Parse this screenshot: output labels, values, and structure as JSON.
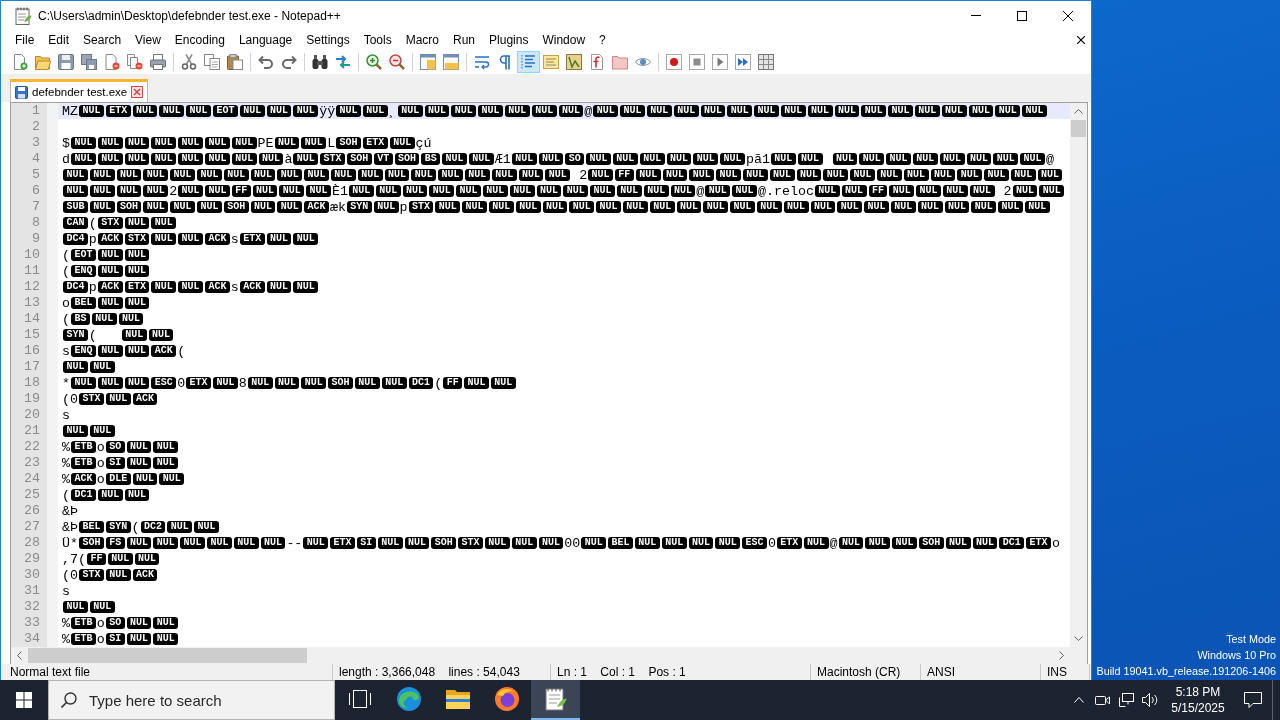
{
  "window": {
    "title": "C:\\Users\\admin\\Desktop\\defebnder test.exe - Notepad++"
  },
  "menu": [
    "File",
    "Edit",
    "Search",
    "View",
    "Encoding",
    "Language",
    "Settings",
    "Tools",
    "Macro",
    "Run",
    "Plugins",
    "Window",
    "?"
  ],
  "toolbar_groups": [
    {
      "buttons": [
        {
          "kind": "new",
          "pressed": false
        },
        {
          "kind": "open",
          "pressed": false
        },
        {
          "kind": "save",
          "pressed": false
        },
        {
          "kind": "save_all",
          "pressed": false
        },
        {
          "kind": "close",
          "pressed": false
        },
        {
          "kind": "close_all",
          "pressed": false
        },
        {
          "kind": "print",
          "pressed": false
        }
      ]
    },
    {
      "buttons": [
        {
          "kind": "cut",
          "pressed": false
        },
        {
          "kind": "copy",
          "pressed": false
        },
        {
          "kind": "paste",
          "pressed": false
        }
      ]
    },
    {
      "buttons": [
        {
          "kind": "undo",
          "pressed": false
        },
        {
          "kind": "redo",
          "pressed": false
        }
      ]
    },
    {
      "buttons": [
        {
          "kind": "find",
          "pressed": false
        },
        {
          "kind": "replace",
          "pressed": false
        }
      ]
    },
    {
      "buttons": [
        {
          "kind": "zoom_in",
          "pressed": false
        },
        {
          "kind": "zoom_out",
          "pressed": false
        }
      ]
    },
    {
      "buttons": [
        {
          "kind": "sync_vertical",
          "pressed": false
        },
        {
          "kind": "sync_horizontal",
          "pressed": false
        }
      ]
    },
    {
      "buttons": [
        {
          "kind": "word_wrap",
          "pressed": false
        },
        {
          "kind": "all_chars",
          "pressed": false
        },
        {
          "kind": "indent_guide",
          "pressed": true
        },
        {
          "kind": "udl",
          "pressed": false
        },
        {
          "kind": "doc_map",
          "pressed": false
        },
        {
          "kind": "function_list",
          "pressed": false
        },
        {
          "kind": "folder_workspace",
          "pressed": false
        },
        {
          "kind": "monitoring",
          "pressed": false
        }
      ]
    },
    {
      "buttons": [
        {
          "kind": "record",
          "pressed": false
        },
        {
          "kind": "stop",
          "pressed": false
        },
        {
          "kind": "play",
          "pressed": false
        },
        {
          "kind": "play_multiple",
          "pressed": false
        },
        {
          "kind": "save_macro",
          "pressed": false
        }
      ]
    }
  ],
  "tabs": [
    {
      "label": "defebnder test.exe",
      "selected": true
    }
  ],
  "editor": {
    "lines": [
      {
        "number": "1",
        "current": true,
        "segments": [
          {
            "kind": "char",
            "text": "MZ"
          },
          {
            "kind": "ctrl",
            "text": "NUL"
          },
          {
            "kind": "ctrl",
            "text": "ETX"
          },
          {
            "kind": "ctrl",
            "text": "NUL"
          },
          {
            "kind": "ctrl",
            "text": "NUL"
          },
          {
            "kind": "ctrl",
            "text": "NUL"
          },
          {
            "kind": "ctrl",
            "text": "EOT"
          },
          {
            "kind": "ctrl",
            "text": "NUL"
          },
          {
            "kind": "ctrl",
            "text": "NUL"
          },
          {
            "kind": "ctrl",
            "text": "NUL"
          },
          {
            "kind": "char",
            "text": "ÿÿ"
          },
          {
            "kind": "ctrl",
            "text": "NUL"
          },
          {
            "kind": "ctrl",
            "text": "NUL"
          },
          {
            "kind": "char",
            "text": "¸"
          },
          {
            "kind": "ctrl",
            "text": "NUL"
          },
          {
            "kind": "ctrl",
            "text": "NUL"
          },
          {
            "kind": "ctrl",
            "text": "NUL"
          },
          {
            "kind": "ctrl",
            "text": "NUL"
          },
          {
            "kind": "ctrl",
            "text": "NUL"
          },
          {
            "kind": "ctrl",
            "text": "NUL"
          },
          {
            "kind": "ctrl",
            "text": "NUL"
          },
          {
            "kind": "char",
            "text": "@"
          },
          {
            "kind": "ctrl",
            "text": "NUL"
          },
          {
            "kind": "ctrl",
            "text": "NUL"
          },
          {
            "kind": "ctrl",
            "text": "NUL"
          },
          {
            "kind": "ctrl",
            "text": "NUL"
          },
          {
            "kind": "ctrl",
            "text": "NUL"
          },
          {
            "kind": "ctrl",
            "text": "NUL"
          },
          {
            "kind": "ctrl",
            "text": "NUL"
          },
          {
            "kind": "ctrl",
            "text": "NUL"
          },
          {
            "kind": "ctrl",
            "text": "NUL"
          },
          {
            "kind": "ctrl",
            "text": "NUL"
          },
          {
            "kind": "ctrl",
            "text": "NUL"
          },
          {
            "kind": "ctrl",
            "text": "NUL"
          },
          {
            "kind": "ctrl",
            "text": "NUL"
          },
          {
            "kind": "ctrl",
            "text": "NUL"
          },
          {
            "kind": "ctrl",
            "text": "NUL"
          },
          {
            "kind": "ctrl",
            "text": "NUL"
          },
          {
            "kind": "ctrl",
            "text": "NUL"
          }
        ]
      },
      {
        "number": "2",
        "current": false
      },
      {
        "number": "3",
        "current": false,
        "segments": [
          {
            "kind": "char",
            "text": "$"
          },
          {
            "kind": "ctrl",
            "text": "NUL"
          },
          {
            "kind": "ctrl",
            "text": "NUL"
          },
          {
            "kind": "ctrl",
            "text": "NUL"
          },
          {
            "kind": "ctrl",
            "text": "NUL"
          },
          {
            "kind": "ctrl",
            "text": "NUL"
          },
          {
            "kind": "ctrl",
            "text": "NUL"
          },
          {
            "kind": "ctrl",
            "text": "NUL"
          },
          {
            "kind": "char",
            "text": "PE"
          },
          {
            "kind": "ctrl",
            "text": "NUL"
          },
          {
            "kind": "ctrl",
            "text": "NUL"
          },
          {
            "kind": "char",
            "text": "L"
          },
          {
            "kind": "ctrl",
            "text": "SOH"
          },
          {
            "kind": "ctrl",
            "text": "ETX"
          },
          {
            "kind": "ctrl",
            "text": "NUL"
          },
          {
            "kind": "char",
            "text": "çú"
          }
        ]
      },
      {
        "number": "4",
        "current": false,
        "segments": [
          {
            "kind": "char",
            "text": "d"
          },
          {
            "kind": "ctrl",
            "text": "NUL"
          },
          {
            "kind": "ctrl",
            "text": "NUL"
          },
          {
            "kind": "ctrl",
            "text": "NUL"
          },
          {
            "kind": "ctrl",
            "text": "NUL"
          },
          {
            "kind": "ctrl",
            "text": "NUL"
          },
          {
            "kind": "ctrl",
            "text": "NUL"
          },
          {
            "kind": "ctrl",
            "text": "NUL"
          },
          {
            "kind": "ctrl",
            "text": "NUL"
          },
          {
            "kind": "char",
            "text": "à"
          },
          {
            "kind": "ctrl",
            "text": "NUL"
          },
          {
            "kind": "ctrl",
            "text": "STX"
          },
          {
            "kind": "ctrl",
            "text": "SOH"
          },
          {
            "kind": "ctrl",
            "text": "VT"
          },
          {
            "kind": "ctrl",
            "text": "SOH"
          },
          {
            "kind": "ctrl",
            "text": "BS"
          },
          {
            "kind": "ctrl",
            "text": "NUL"
          },
          {
            "kind": "ctrl",
            "text": "NUL"
          },
          {
            "kind": "char",
            "text": "Æ1"
          },
          {
            "kind": "ctrl",
            "text": "NUL"
          },
          {
            "kind": "ctrl",
            "text": "NUL"
          },
          {
            "kind": "ctrl",
            "text": "SO"
          },
          {
            "kind": "ctrl",
            "text": "NUL"
          },
          {
            "kind": "ctrl",
            "text": "NUL"
          },
          {
            "kind": "ctrl",
            "text": "NUL"
          },
          {
            "kind": "ctrl",
            "text": "NUL"
          },
          {
            "kind": "ctrl",
            "text": "NUL"
          },
          {
            "kind": "ctrl",
            "text": "NUL"
          },
          {
            "kind": "char",
            "text": "pã1"
          },
          {
            "kind": "ctrl",
            "text": "NUL"
          },
          {
            "kind": "ctrl",
            "text": "NUL"
          },
          {
            "kind": "space"
          },
          {
            "kind": "ctrl",
            "text": "NUL"
          },
          {
            "kind": "ctrl",
            "text": "NUL"
          },
          {
            "kind": "ctrl",
            "text": "NUL"
          },
          {
            "kind": "ctrl",
            "text": "NUL"
          },
          {
            "kind": "ctrl",
            "text": "NUL"
          },
          {
            "kind": "ctrl",
            "text": "NUL"
          },
          {
            "kind": "ctrl",
            "text": "NUL"
          },
          {
            "kind": "ctrl",
            "text": "NUL"
          },
          {
            "kind": "char",
            "text": "@"
          }
        ]
      },
      {
        "number": "5",
        "current": false,
        "segments": [
          {
            "kind": "ctrl",
            "text": "NUL"
          },
          {
            "kind": "ctrl",
            "text": "NUL"
          },
          {
            "kind": "ctrl",
            "text": "NUL"
          },
          {
            "kind": "ctrl",
            "text": "NUL"
          },
          {
            "kind": "ctrl",
            "text": "NUL"
          },
          {
            "kind": "ctrl",
            "text": "NUL"
          },
          {
            "kind": "ctrl",
            "text": "NUL"
          },
          {
            "kind": "ctrl",
            "text": "NUL"
          },
          {
            "kind": "ctrl",
            "text": "NUL"
          },
          {
            "kind": "ctrl",
            "text": "NUL"
          },
          {
            "kind": "ctrl",
            "text": "NUL"
          },
          {
            "kind": "ctrl",
            "text": "NUL"
          },
          {
            "kind": "ctrl",
            "text": "NUL"
          },
          {
            "kind": "ctrl",
            "text": "NUL"
          },
          {
            "kind": "ctrl",
            "text": "NUL"
          },
          {
            "kind": "ctrl",
            "text": "NUL"
          },
          {
            "kind": "ctrl",
            "text": "NUL"
          },
          {
            "kind": "ctrl",
            "text": "NUL"
          },
          {
            "kind": "ctrl",
            "text": "NUL"
          },
          {
            "kind": "char",
            "text": " 2"
          },
          {
            "kind": "ctrl",
            "text": "NUL"
          },
          {
            "kind": "ctrl",
            "text": "FF"
          },
          {
            "kind": "ctrl",
            "text": "NUL"
          },
          {
            "kind": "ctrl",
            "text": "NUL"
          },
          {
            "kind": "ctrl",
            "text": "NUL"
          },
          {
            "kind": "ctrl",
            "text": "NUL"
          },
          {
            "kind": "ctrl",
            "text": "NUL"
          },
          {
            "kind": "ctrl",
            "text": "NUL"
          },
          {
            "kind": "ctrl",
            "text": "NUL"
          },
          {
            "kind": "ctrl",
            "text": "NUL"
          },
          {
            "kind": "ctrl",
            "text": "NUL"
          },
          {
            "kind": "ctrl",
            "text": "NUL"
          },
          {
            "kind": "ctrl",
            "text": "NUL"
          },
          {
            "kind": "ctrl",
            "text": "NUL"
          },
          {
            "kind": "ctrl",
            "text": "NUL"
          },
          {
            "kind": "ctrl",
            "text": "NUL"
          },
          {
            "kind": "ctrl",
            "text": "NUL"
          },
          {
            "kind": "ctrl",
            "text": "NUL"
          }
        ]
      },
      {
        "number": "6",
        "current": false,
        "segments": [
          {
            "kind": "ctrl",
            "text": "NUL"
          },
          {
            "kind": "ctrl",
            "text": "NUL"
          },
          {
            "kind": "ctrl",
            "text": "NUL"
          },
          {
            "kind": "ctrl",
            "text": "NUL"
          },
          {
            "kind": "char",
            "text": "2"
          },
          {
            "kind": "ctrl",
            "text": "NUL"
          },
          {
            "kind": "ctrl",
            "text": "NUL"
          },
          {
            "kind": "ctrl",
            "text": "FF"
          },
          {
            "kind": "ctrl",
            "text": "NUL"
          },
          {
            "kind": "ctrl",
            "text": "NUL"
          },
          {
            "kind": "ctrl",
            "text": "NUL"
          },
          {
            "kind": "char",
            "text": "È1"
          },
          {
            "kind": "ctrl",
            "text": "NUL"
          },
          {
            "kind": "ctrl",
            "text": "NUL"
          },
          {
            "kind": "ctrl",
            "text": "NUL"
          },
          {
            "kind": "ctrl",
            "text": "NUL"
          },
          {
            "kind": "ctrl",
            "text": "NUL"
          },
          {
            "kind": "ctrl",
            "text": "NUL"
          },
          {
            "kind": "ctrl",
            "text": "NUL"
          },
          {
            "kind": "ctrl",
            "text": "NUL"
          },
          {
            "kind": "ctrl",
            "text": "NUL"
          },
          {
            "kind": "ctrl",
            "text": "NUL"
          },
          {
            "kind": "ctrl",
            "text": "NUL"
          },
          {
            "kind": "ctrl",
            "text": "NUL"
          },
          {
            "kind": "ctrl",
            "text": "NUL"
          },
          {
            "kind": "char",
            "text": "@"
          },
          {
            "kind": "ctrl",
            "text": "NUL"
          },
          {
            "kind": "ctrl",
            "text": "NUL"
          },
          {
            "kind": "char",
            "text": "@.reloc"
          },
          {
            "kind": "ctrl",
            "text": "NUL"
          },
          {
            "kind": "ctrl",
            "text": "NUL"
          },
          {
            "kind": "ctrl",
            "text": "FF"
          },
          {
            "kind": "ctrl",
            "text": "NUL"
          },
          {
            "kind": "ctrl",
            "text": "NUL"
          },
          {
            "kind": "ctrl",
            "text": "NUL"
          },
          {
            "kind": "ctrl",
            "text": "NUL"
          },
          {
            "kind": "char",
            "text": " 2"
          },
          {
            "kind": "ctrl",
            "text": "NUL"
          },
          {
            "kind": "ctrl",
            "text": "NUL"
          }
        ]
      },
      {
        "number": "7",
        "current": false,
        "segments": [
          {
            "kind": "ctrl",
            "text": "SUB"
          },
          {
            "kind": "ctrl",
            "text": "NUL"
          },
          {
            "kind": "ctrl",
            "text": "SOH"
          },
          {
            "kind": "ctrl",
            "text": "NUL"
          },
          {
            "kind": "ctrl",
            "text": "NUL"
          },
          {
            "kind": "ctrl",
            "text": "NUL"
          },
          {
            "kind": "ctrl",
            "text": "SOH"
          },
          {
            "kind": "ctrl",
            "text": "NUL"
          },
          {
            "kind": "ctrl",
            "text": "NUL"
          },
          {
            "kind": "ctrl",
            "text": "ACK"
          },
          {
            "kind": "char",
            "text": "æk"
          },
          {
            "kind": "ctrl",
            "text": "SYN"
          },
          {
            "kind": "ctrl",
            "text": "NUL"
          },
          {
            "kind": "char",
            "text": "p"
          },
          {
            "kind": "ctrl",
            "text": "STX"
          },
          {
            "kind": "ctrl",
            "text": "NUL"
          },
          {
            "kind": "ctrl",
            "text": "NUL"
          },
          {
            "kind": "ctrl",
            "text": "NUL"
          },
          {
            "kind": "ctrl",
            "text": "NUL"
          },
          {
            "kind": "ctrl",
            "text": "NUL"
          },
          {
            "kind": "ctrl",
            "text": "NUL"
          },
          {
            "kind": "ctrl",
            "text": "NUL"
          },
          {
            "kind": "ctrl",
            "text": "NUL"
          },
          {
            "kind": "ctrl",
            "text": "NUL"
          },
          {
            "kind": "ctrl",
            "text": "NUL"
          },
          {
            "kind": "ctrl",
            "text": "NUL"
          },
          {
            "kind": "ctrl",
            "text": "NUL"
          },
          {
            "kind": "ctrl",
            "text": "NUL"
          },
          {
            "kind": "ctrl",
            "text": "NUL"
          },
          {
            "kind": "ctrl",
            "text": "NUL"
          },
          {
            "kind": "ctrl",
            "text": "NUL"
          },
          {
            "kind": "ctrl",
            "text": "NUL"
          },
          {
            "kind": "ctrl",
            "text": "NUL"
          },
          {
            "kind": "ctrl",
            "text": "NUL"
          },
          {
            "kind": "ctrl",
            "text": "NUL"
          },
          {
            "kind": "ctrl",
            "text": "NUL"
          },
          {
            "kind": "ctrl",
            "text": "NUL"
          },
          {
            "kind": "ctrl",
            "text": "NUL"
          }
        ]
      },
      {
        "number": "8",
        "current": false,
        "segments": [
          {
            "kind": "ctrl",
            "text": "CAN"
          },
          {
            "kind": "char",
            "text": "("
          },
          {
            "kind": "ctrl",
            "text": "STX"
          },
          {
            "kind": "ctrl",
            "text": "NUL"
          },
          {
            "kind": "ctrl",
            "text": "NUL"
          }
        ]
      },
      {
        "number": "9",
        "current": false,
        "segments": [
          {
            "kind": "ctrl",
            "text": "DC4"
          },
          {
            "kind": "char",
            "text": "p"
          },
          {
            "kind": "ctrl",
            "text": "ACK"
          },
          {
            "kind": "ctrl",
            "text": "STX"
          },
          {
            "kind": "ctrl",
            "text": "NUL"
          },
          {
            "kind": "ctrl",
            "text": "NUL"
          },
          {
            "kind": "ctrl",
            "text": "ACK"
          },
          {
            "kind": "char",
            "text": "s"
          },
          {
            "kind": "ctrl",
            "text": "ETX"
          },
          {
            "kind": "ctrl",
            "text": "NUL"
          },
          {
            "kind": "ctrl",
            "text": "NUL"
          }
        ]
      },
      {
        "number": "10",
        "current": false,
        "segments": [
          {
            "kind": "char",
            "text": "("
          },
          {
            "kind": "ctrl",
            "text": "EOT"
          },
          {
            "kind": "ctrl",
            "text": "NUL"
          },
          {
            "kind": "ctrl",
            "text": "NUL"
          }
        ]
      },
      {
        "number": "11",
        "current": false,
        "segments": [
          {
            "kind": "char",
            "text": "("
          },
          {
            "kind": "ctrl",
            "text": "ENQ"
          },
          {
            "kind": "ctrl",
            "text": "NUL"
          },
          {
            "kind": "ctrl",
            "text": "NUL"
          }
        ]
      },
      {
        "number": "12",
        "current": false,
        "segments": [
          {
            "kind": "ctrl",
            "text": "DC4"
          },
          {
            "kind": "char",
            "text": "p"
          },
          {
            "kind": "ctrl",
            "text": "ACK"
          },
          {
            "kind": "ctrl",
            "text": "ETX"
          },
          {
            "kind": "ctrl",
            "text": "NUL"
          },
          {
            "kind": "ctrl",
            "text": "NUL"
          },
          {
            "kind": "ctrl",
            "text": "ACK"
          },
          {
            "kind": "char",
            "text": "s"
          },
          {
            "kind": "ctrl",
            "text": "ACK"
          },
          {
            "kind": "ctrl",
            "text": "NUL"
          },
          {
            "kind": "ctrl",
            "text": "NUL"
          }
        ]
      },
      {
        "number": "13",
        "current": false,
        "segments": [
          {
            "kind": "char",
            "text": "o"
          },
          {
            "kind": "ctrl",
            "text": "BEL"
          },
          {
            "kind": "ctrl",
            "text": "NUL"
          },
          {
            "kind": "ctrl",
            "text": "NUL"
          }
        ]
      },
      {
        "number": "14",
        "current": false,
        "segments": [
          {
            "kind": "char",
            "text": "("
          },
          {
            "kind": "ctrl",
            "text": "BS"
          },
          {
            "kind": "ctrl",
            "text": "NUL"
          },
          {
            "kind": "ctrl",
            "text": "NUL"
          }
        ]
      },
      {
        "number": "15",
        "current": false,
        "segments": [
          {
            "kind": "ctrl",
            "text": "SYN"
          },
          {
            "kind": "char",
            "text": "(   "
          },
          {
            "kind": "ctrl",
            "text": "NUL"
          },
          {
            "kind": "ctrl",
            "text": "NUL"
          }
        ]
      },
      {
        "number": "16",
        "current": false,
        "segments": [
          {
            "kind": "char",
            "text": "s"
          },
          {
            "kind": "ctrl",
            "text": "ENQ"
          },
          {
            "kind": "ctrl",
            "text": "NUL"
          },
          {
            "kind": "ctrl",
            "text": "NUL"
          },
          {
            "kind": "ctrl",
            "text": "ACK"
          },
          {
            "kind": "char",
            "text": "("
          }
        ]
      },
      {
        "number": "17",
        "current": false,
        "segments": [
          {
            "kind": "ctrl",
            "text": "NUL"
          },
          {
            "kind": "ctrl",
            "text": "NUL"
          }
        ]
      },
      {
        "number": "18",
        "current": false,
        "segments": [
          {
            "kind": "char",
            "text": "*"
          },
          {
            "kind": "ctrl",
            "text": "NUL"
          },
          {
            "kind": "ctrl",
            "text": "NUL"
          },
          {
            "kind": "ctrl",
            "text": "NUL"
          },
          {
            "kind": "ctrl",
            "text": "ESC"
          },
          {
            "kind": "char",
            "text": "0"
          },
          {
            "kind": "ctrl",
            "text": "ETX"
          },
          {
            "kind": "ctrl",
            "text": "NUL"
          },
          {
            "kind": "char",
            "text": "8"
          },
          {
            "kind": "ctrl",
            "text": "NUL"
          },
          {
            "kind": "ctrl",
            "text": "NUL"
          },
          {
            "kind": "ctrl",
            "text": "NUL"
          },
          {
            "kind": "ctrl",
            "text": "SOH"
          },
          {
            "kind": "ctrl",
            "text": "NUL"
          },
          {
            "kind": "ctrl",
            "text": "NUL"
          },
          {
            "kind": "ctrl",
            "text": "DC1"
          },
          {
            "kind": "char",
            "text": "("
          },
          {
            "kind": "ctrl",
            "text": "FF"
          },
          {
            "kind": "ctrl",
            "text": "NUL"
          },
          {
            "kind": "ctrl",
            "text": "NUL"
          }
        ]
      },
      {
        "number": "19",
        "current": false,
        "segments": [
          {
            "kind": "char",
            "text": "(0"
          },
          {
            "kind": "ctrl",
            "text": "STX"
          },
          {
            "kind": "ctrl",
            "text": "NUL"
          },
          {
            "kind": "ctrl",
            "text": "ACK"
          }
        ]
      },
      {
        "number": "20",
        "current": false,
        "segments": [
          {
            "kind": "char",
            "text": "s"
          }
        ]
      },
      {
        "number": "21",
        "current": false,
        "segments": [
          {
            "kind": "ctrl",
            "text": "NUL"
          },
          {
            "kind": "ctrl",
            "text": "NUL"
          }
        ]
      },
      {
        "number": "22",
        "current": false,
        "segments": [
          {
            "kind": "char",
            "text": "%"
          },
          {
            "kind": "ctrl",
            "text": "ETB"
          },
          {
            "kind": "char",
            "text": "o"
          },
          {
            "kind": "ctrl",
            "text": "SO"
          },
          {
            "kind": "ctrl",
            "text": "NUL"
          },
          {
            "kind": "ctrl",
            "text": "NUL"
          }
        ]
      },
      {
        "number": "23",
        "current": false,
        "segments": [
          {
            "kind": "char",
            "text": "%"
          },
          {
            "kind": "ctrl",
            "text": "ETB"
          },
          {
            "kind": "char",
            "text": "o"
          },
          {
            "kind": "ctrl",
            "text": "SI"
          },
          {
            "kind": "ctrl",
            "text": "NUL"
          },
          {
            "kind": "ctrl",
            "text": "NUL"
          }
        ]
      },
      {
        "number": "24",
        "current": false,
        "segments": [
          {
            "kind": "char",
            "text": "%"
          },
          {
            "kind": "ctrl",
            "text": "ACK"
          },
          {
            "kind": "char",
            "text": "o"
          },
          {
            "kind": "ctrl",
            "text": "DLE"
          },
          {
            "kind": "ctrl",
            "text": "NUL"
          },
          {
            "kind": "ctrl",
            "text": "NUL"
          }
        ]
      },
      {
        "number": "25",
        "current": false,
        "segments": [
          {
            "kind": "char",
            "text": "("
          },
          {
            "kind": "ctrl",
            "text": "DC1"
          },
          {
            "kind": "ctrl",
            "text": "NUL"
          },
          {
            "kind": "ctrl",
            "text": "NUL"
          }
        ]
      },
      {
        "number": "26",
        "current": false,
        "segments": [
          {
            "kind": "char",
            "text": "&Þ"
          }
        ]
      },
      {
        "number": "27",
        "current": false,
        "segments": [
          {
            "kind": "char",
            "text": "&Þ"
          },
          {
            "kind": "ctrl",
            "text": "BEL"
          },
          {
            "kind": "ctrl",
            "text": "SYN"
          },
          {
            "kind": "char",
            "text": "("
          },
          {
            "kind": "ctrl",
            "text": "DC2"
          },
          {
            "kind": "ctrl",
            "text": "NUL"
          },
          {
            "kind": "ctrl",
            "text": "NUL"
          }
        ]
      },
      {
        "number": "28",
        "current": false,
        "segments": [
          {
            "kind": "char",
            "text": "Ü*"
          },
          {
            "kind": "ctrl",
            "text": "SOH"
          },
          {
            "kind": "ctrl",
            "text": "FS"
          },
          {
            "kind": "ctrl",
            "text": "NUL"
          },
          {
            "kind": "ctrl",
            "text": "NUL"
          },
          {
            "kind": "ctrl",
            "text": "NUL"
          },
          {
            "kind": "ctrl",
            "text": "NUL"
          },
          {
            "kind": "ctrl",
            "text": "NUL"
          },
          {
            "kind": "ctrl",
            "text": "NUL"
          },
          {
            "kind": "char",
            "text": "--"
          },
          {
            "kind": "ctrl",
            "text": "NUL"
          },
          {
            "kind": "ctrl",
            "text": "ETX"
          },
          {
            "kind": "ctrl",
            "text": "SI"
          },
          {
            "kind": "ctrl",
            "text": "NUL"
          },
          {
            "kind": "ctrl",
            "text": "NUL"
          },
          {
            "kind": "ctrl",
            "text": "SOH"
          },
          {
            "kind": "ctrl",
            "text": "STX"
          },
          {
            "kind": "ctrl",
            "text": "NUL"
          },
          {
            "kind": "ctrl",
            "text": "NUL"
          },
          {
            "kind": "ctrl",
            "text": "NUL"
          },
          {
            "kind": "char",
            "text": "00"
          },
          {
            "kind": "ctrl",
            "text": "NUL"
          },
          {
            "kind": "ctrl",
            "text": "BEL"
          },
          {
            "kind": "ctrl",
            "text": "NUL"
          },
          {
            "kind": "ctrl",
            "text": "NUL"
          },
          {
            "kind": "ctrl",
            "text": "NUL"
          },
          {
            "kind": "ctrl",
            "text": "NUL"
          },
          {
            "kind": "ctrl",
            "text": "ESC"
          },
          {
            "kind": "char",
            "text": "0"
          },
          {
            "kind": "ctrl",
            "text": "ETX"
          },
          {
            "kind": "ctrl",
            "text": "NUL"
          },
          {
            "kind": "char",
            "text": "@"
          },
          {
            "kind": "ctrl",
            "text": "NUL"
          },
          {
            "kind": "ctrl",
            "text": "NUL"
          },
          {
            "kind": "ctrl",
            "text": "NUL"
          },
          {
            "kind": "ctrl",
            "text": "SOH"
          },
          {
            "kind": "ctrl",
            "text": "NUL"
          },
          {
            "kind": "ctrl",
            "text": "NUL"
          },
          {
            "kind": "ctrl",
            "text": "DC1"
          },
          {
            "kind": "ctrl",
            "text": "ETX"
          },
          {
            "kind": "char",
            "text": "o"
          }
        ]
      },
      {
        "number": "29",
        "current": false,
        "segments": [
          {
            "kind": "char",
            "text": ",7("
          },
          {
            "kind": "ctrl",
            "text": "FF"
          },
          {
            "kind": "ctrl",
            "text": "NUL"
          },
          {
            "kind": "ctrl",
            "text": "NUL"
          }
        ]
      },
      {
        "number": "30",
        "current": false,
        "segments": [
          {
            "kind": "char",
            "text": "(0"
          },
          {
            "kind": "ctrl",
            "text": "STX"
          },
          {
            "kind": "ctrl",
            "text": "NUL"
          },
          {
            "kind": "ctrl",
            "text": "ACK"
          }
        ]
      },
      {
        "number": "31",
        "current": false,
        "segments": [
          {
            "kind": "char",
            "text": "s"
          }
        ]
      },
      {
        "number": "32",
        "current": false,
        "segments": [
          {
            "kind": "ctrl",
            "text": "NUL"
          },
          {
            "kind": "ctrl",
            "text": "NUL"
          }
        ]
      },
      {
        "number": "33",
        "current": false,
        "segments": [
          {
            "kind": "char",
            "text": "%"
          },
          {
            "kind": "ctrl",
            "text": "ETB"
          },
          {
            "kind": "char",
            "text": "o"
          },
          {
            "kind": "ctrl",
            "text": "SO"
          },
          {
            "kind": "ctrl",
            "text": "NUL"
          },
          {
            "kind": "ctrl",
            "text": "NUL"
          }
        ]
      },
      {
        "number": "34",
        "current": false,
        "segments": [
          {
            "kind": "char",
            "text": "%"
          },
          {
            "kind": "ctrl",
            "text": "ETB"
          },
          {
            "kind": "char",
            "text": "o"
          },
          {
            "kind": "ctrl",
            "text": "SI"
          },
          {
            "kind": "ctrl",
            "text": "NUL"
          },
          {
            "kind": "ctrl",
            "text": "NUL"
          }
        ]
      }
    ]
  },
  "status_bar": [
    "Normal text file",
    "length : 3,366,048    lines : 54,043",
    "Ln : 1    Col : 1    Pos : 1",
    "Macintosh (CR)",
    "ANSI",
    "INS"
  ],
  "desktop": {
    "notice": [
      "Test Mode",
      "Windows 10 Pro",
      "Build 19041.vb_release.191206-1406"
    ]
  },
  "taskbar": {
    "search": {
      "placeholder": "Type here to search"
    },
    "apps": [
      {
        "kind": "task_view",
        "active": false
      },
      {
        "kind": "swirl_browser",
        "active": false
      },
      {
        "kind": "file_manager",
        "active": false
      },
      {
        "kind": "globe_browser",
        "active": false
      },
      {
        "kind": "text_editor",
        "active": true
      }
    ],
    "time": "5:18 PM",
    "date": "5/15/2025"
  }
}
